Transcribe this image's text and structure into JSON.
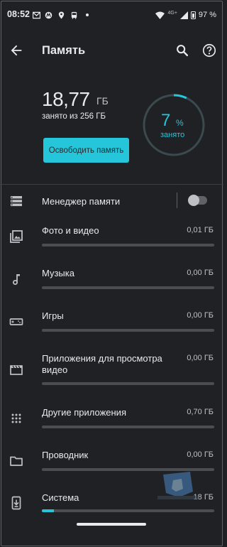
{
  "status_bar": {
    "time": "08:52",
    "network": "4G+",
    "battery": "97 %"
  },
  "app_bar": {
    "title": "Память"
  },
  "summary": {
    "used_value": "18,77",
    "used_unit": "ГБ",
    "used_of": "занято из 256 ГБ",
    "free_button": "Освободить память",
    "percent_value": "7",
    "percent_sign": "%",
    "percent_label": "занято",
    "percent_fraction": 0.07
  },
  "storage_manager": {
    "label": "Менеджер памяти",
    "enabled": false
  },
  "categories": [
    {
      "label": "Фото и видео",
      "size": "0,01 ГБ",
      "icon": "photo-icon",
      "fill": 0.0
    },
    {
      "label": "Музыка",
      "size": "0,00 ГБ",
      "icon": "music-icon",
      "fill": 0.0
    },
    {
      "label": "Игры",
      "size": "0,00 ГБ",
      "icon": "gamepad-icon",
      "fill": 0.0
    },
    {
      "label": "Приложения для просмотра видео",
      "size": "0,00 ГБ",
      "icon": "movie-icon",
      "fill": 0.0
    },
    {
      "label": "Другие приложения",
      "size": "0,70 ГБ",
      "icon": "apps-grid-icon",
      "fill": 0.0
    },
    {
      "label": "Проводник",
      "size": "0,00 ГБ",
      "icon": "folder-icon",
      "fill": 0.0
    },
    {
      "label": "Система",
      "size": "18 ГБ",
      "icon": "system-update-icon",
      "fill": 0.07
    }
  ],
  "colors": {
    "accent": "#26c6da",
    "background": "#202124"
  }
}
